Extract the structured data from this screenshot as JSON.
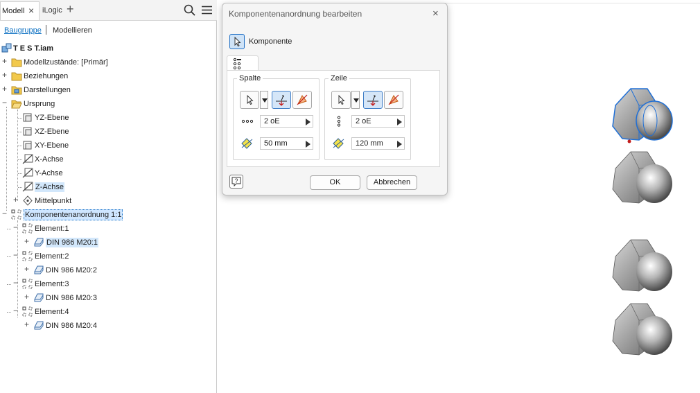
{
  "browser": {
    "tabs": [
      {
        "label": "Modell",
        "close": "×"
      },
      {
        "label": "iLogic"
      }
    ],
    "add_tab_icon": "+",
    "modes": {
      "assembly": "Baugruppe",
      "model": "Modellieren"
    },
    "tree": {
      "root": "T E S T.iam",
      "model_states": "Modellzustände: [Primär]",
      "relations": "Beziehungen",
      "representations": "Darstellungen",
      "origin": "Ursprung",
      "origin_items": [
        "YZ-Ebene",
        "XZ-Ebene",
        "XY-Ebene",
        "X-Achse",
        "Y-Achse",
        "Z-Achse"
      ],
      "center_point": "Mittelpunkt",
      "pattern": "Komponentenanordnung 1:1",
      "elements": [
        {
          "label": "Element:1",
          "part": "DIN 986 M20:1"
        },
        {
          "label": "Element:2",
          "part": "DIN 986 M20:2"
        },
        {
          "label": "Element:3",
          "part": "DIN 986 M20:3"
        },
        {
          "label": "Element:4",
          "part": "DIN 986 M20:4"
        }
      ]
    }
  },
  "dialog": {
    "title": "Komponentenanordnung bearbeiten",
    "close": "×",
    "component_label": "Komponente",
    "column": {
      "title": "Spalte",
      "count": "2 oE",
      "spacing": "50 mm"
    },
    "row": {
      "title": "Zeile",
      "count": "2 oE",
      "spacing": "120 mm"
    },
    "ok": "OK",
    "cancel": "Abbrechen"
  },
  "colors": {
    "accent": "#0a6fc2",
    "selection": "#cfe6ff",
    "folder": "#f2c94c"
  },
  "icons": [
    "search-icon",
    "menu-icon",
    "assembly-icon",
    "folder-icon",
    "plane-icon",
    "axis-icon",
    "point-icon",
    "pattern-icon",
    "part-icon",
    "select-arrow-icon",
    "flip-icon",
    "path-icon",
    "count-icon",
    "spacing-icon",
    "help-icon"
  ]
}
